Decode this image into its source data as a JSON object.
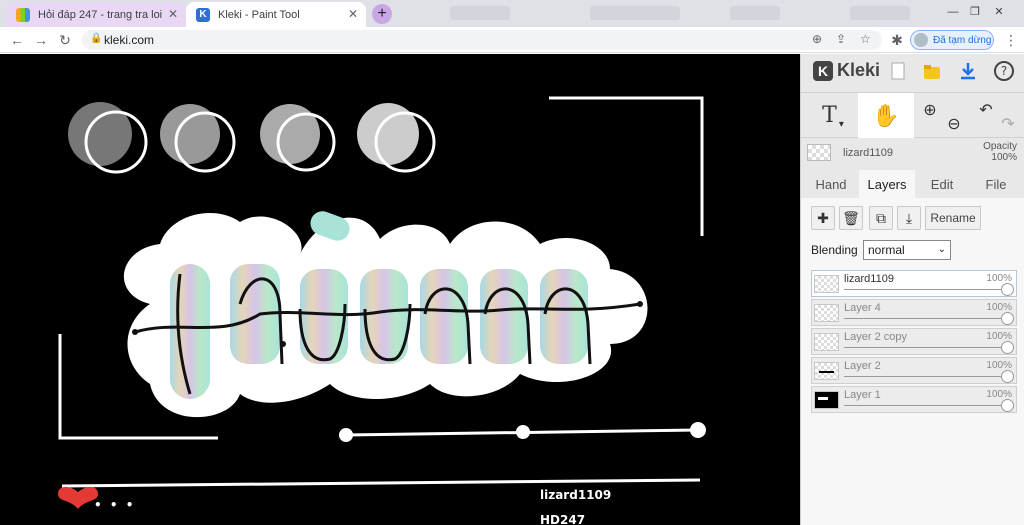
{
  "browser": {
    "tabs": [
      {
        "title": "Hỏi đáp 247 - trang tra loi",
        "active": false
      },
      {
        "title": "Kleki - Paint Tool",
        "active": true
      }
    ],
    "url": "kleki.com",
    "profile_label": "Đã tạm dừng",
    "icons": [
      "back-icon",
      "forward-icon",
      "reload-icon",
      "lock-icon",
      "zoom-icon",
      "share-icon",
      "star-icon",
      "extensions-icon",
      "menu-icon"
    ]
  },
  "canvas": {
    "credit_name": "lizard1109",
    "credit_site": "HD247",
    "dots": "• • •",
    "colors": {
      "background": "#000000",
      "stroke": "#ffffff",
      "accent": "#e53935"
    }
  },
  "panel": {
    "brand": "Kleki",
    "tools": [
      "text-tool",
      "hand-tool",
      "zoom-in",
      "zoom-out",
      "undo",
      "redo"
    ],
    "brush_name": "lizard1109",
    "opacity_label": "Opacity",
    "opacity_value": "100%",
    "tabs": [
      {
        "label": "Hand",
        "active": false
      },
      {
        "label": "Layers",
        "active": true
      },
      {
        "label": "Edit",
        "active": false
      },
      {
        "label": "File",
        "active": false
      }
    ],
    "rename_label": "Rename",
    "blending_label": "Blending",
    "blending_value": "normal",
    "layers": [
      {
        "name": "lizard1109",
        "opacity": "100%",
        "selected": true
      },
      {
        "name": "Layer 4",
        "opacity": "100%",
        "selected": false
      },
      {
        "name": "Layer 2 copy",
        "opacity": "100%",
        "selected": false
      },
      {
        "name": "Layer 2",
        "opacity": "100%",
        "selected": false
      },
      {
        "name": "Layer 1",
        "opacity": "100%",
        "selected": false
      }
    ]
  }
}
